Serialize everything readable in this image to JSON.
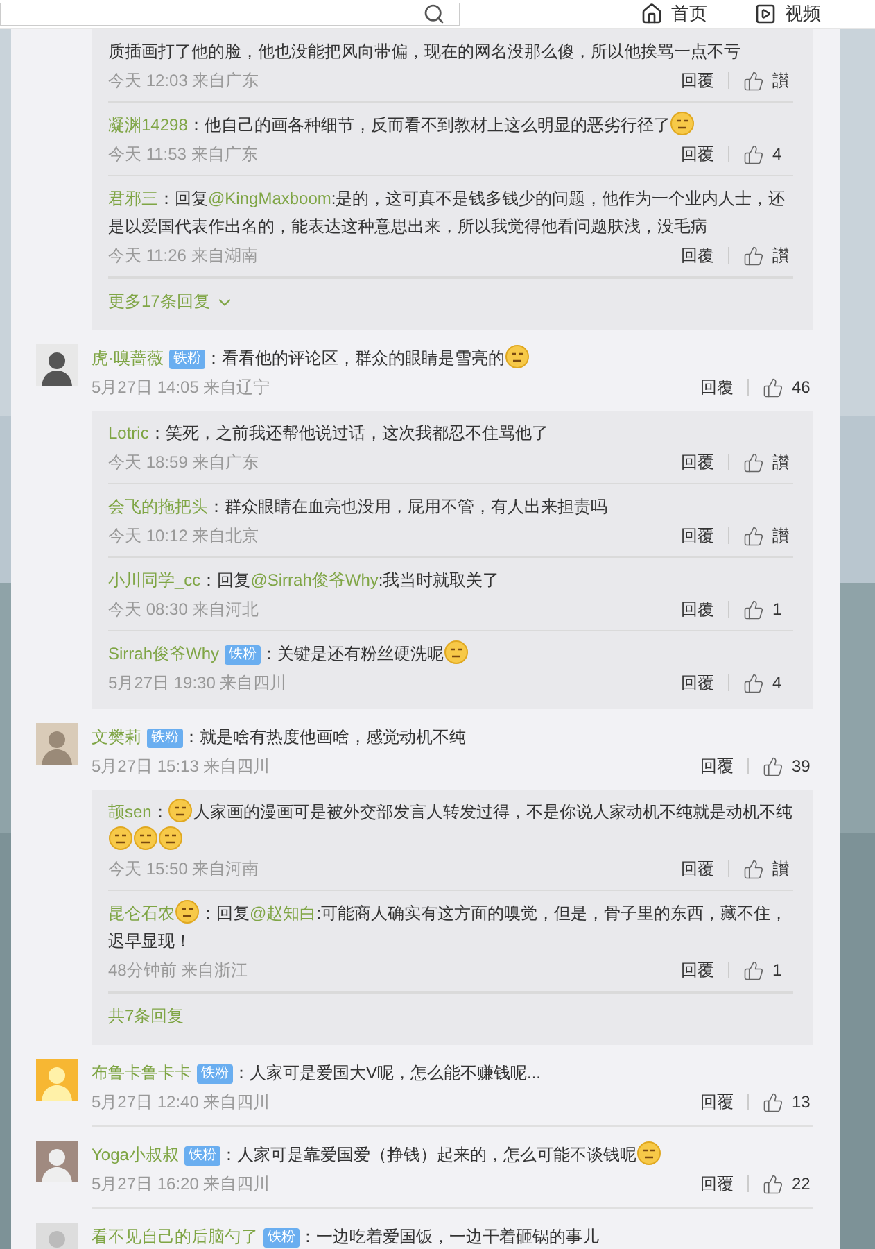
{
  "header": {
    "nav": [
      {
        "kind": "home",
        "label": "首页"
      },
      {
        "kind": "video",
        "label": "视频"
      }
    ]
  },
  "threads": [
    {
      "replies": [
        {
          "parts": [
            {
              "kind": "text",
              "text": "质插画打了他的脸，他也没能把风向带偏，现在的网名没那么傻，所以他挨骂一点不亏"
            }
          ],
          "time": "今天 12:03 来自广东",
          "reply": "回覆",
          "like": "讃"
        },
        {
          "author": "凝渊14298",
          "parts": [
            {
              "kind": "text",
              "text": "：他自己的画各种细节，反而看不到教材上这么明显的恶劣行径了"
            },
            {
              "kind": "emoji"
            }
          ],
          "time": "今天 11:53 来自广东",
          "reply": "回覆",
          "like": "4"
        },
        {
          "author": "君邪三",
          "parts": [
            {
              "kind": "text",
              "text": "：回复"
            },
            {
              "kind": "mention",
              "text": "@KingMaxboom"
            },
            {
              "kind": "text",
              "text": ":是的，这可真不是钱多钱少的问题，他作为一个业内人士，还是以爱国代表作出名的，能表达这种意思出来，所以我觉得他看问题肤浅，没毛病"
            }
          ],
          "time": "今天 11:26 来自湖南",
          "reply": "回覆",
          "like": "讃"
        }
      ],
      "footer": {
        "text": "更多17条回复",
        "chevron": true
      }
    },
    {
      "comment": {
        "author": "虎·嗅蔷薇",
        "badge": "铁粉",
        "parts": [
          {
            "kind": "text",
            "text": "：看看他的评论区，群众的眼睛是雪亮的"
          },
          {
            "kind": "emoji"
          }
        ],
        "time": "5月27日 14:05 来自辽宁",
        "reply": "回覆",
        "like": "46"
      },
      "replies": [
        {
          "author": "Lotric",
          "parts": [
            {
              "kind": "text",
              "text": "：笑死，之前我还帮他说过话，这次我都忍不住骂他了"
            }
          ],
          "time": "今天 18:59 来自广东",
          "reply": "回覆",
          "like": "讃"
        },
        {
          "author": "会飞的拖把头",
          "parts": [
            {
              "kind": "text",
              "text": "：群众眼睛在血亮也没用，屁用不管，有人出来担责吗"
            }
          ],
          "time": "今天 10:12 来自北京",
          "reply": "回覆",
          "like": "讃"
        },
        {
          "author": "小川同学_cc",
          "parts": [
            {
              "kind": "text",
              "text": "：回复"
            },
            {
              "kind": "mention",
              "text": "@Sirrah俊爷Why"
            },
            {
              "kind": "text",
              "text": ":我当时就取关了"
            }
          ],
          "time": "今天 08:30 来自河北",
          "reply": "回覆",
          "like": "1"
        },
        {
          "author": "Sirrah俊爷Why",
          "badge": "铁粉",
          "parts": [
            {
              "kind": "text",
              "text": "：关键是还有粉丝硬洗呢"
            },
            {
              "kind": "emoji"
            }
          ],
          "time": "5月27日 19:30 来自四川",
          "reply": "回覆",
          "like": "4"
        }
      ]
    },
    {
      "comment": {
        "author": "文樊莉",
        "badge": "铁粉",
        "parts": [
          {
            "kind": "text",
            "text": "：就是啥有热度他画啥，感觉动机不纯"
          }
        ],
        "time": "5月27日 15:13 来自四川",
        "reply": "回覆",
        "like": "39"
      },
      "replies": [
        {
          "author": "颉sen",
          "parts": [
            {
              "kind": "text",
              "text": "："
            },
            {
              "kind": "emoji"
            },
            {
              "kind": "text",
              "text": "人家画的漫画可是被外交部发言人转发过得，不是你说人家动机不纯就是动机不纯"
            },
            {
              "kind": "emoji"
            },
            {
              "kind": "emoji"
            },
            {
              "kind": "emoji"
            }
          ],
          "time": "今天 15:50 来自河南",
          "reply": "回覆",
          "like": "讃"
        },
        {
          "author": "昆仑石农",
          "parts": [
            {
              "kind": "emoji"
            },
            {
              "kind": "text",
              "text": "：回复"
            },
            {
              "kind": "mention",
              "text": "@赵知白"
            },
            {
              "kind": "text",
              "text": ":可能商人确实有这方面的嗅觉，但是，骨子里的东西，藏不住，迟早显现！"
            }
          ],
          "time": "48分钟前 来自浙江",
          "reply": "回覆",
          "like": "1"
        }
      ],
      "footer": {
        "text": "共7条回复",
        "chevron": false
      }
    },
    {
      "comment": {
        "author": "布鲁卡鲁卡卡",
        "badge": "铁粉",
        "parts": [
          {
            "kind": "text",
            "text": "：人家可是爱国大V呢，怎么能不赚钱呢..."
          }
        ],
        "time": "5月27日 12:40 来自四川",
        "reply": "回覆",
        "like": "13"
      }
    },
    {
      "comment": {
        "author": "Yoga小叔叔",
        "badge": "铁粉",
        "parts": [
          {
            "kind": "text",
            "text": "：人家可是靠爱国爱（挣钱）起来的，怎么可能不谈钱呢"
          },
          {
            "kind": "emoji"
          }
        ],
        "time": "5月27日 16:20 来自四川",
        "reply": "回覆",
        "like": "22"
      }
    },
    {
      "comment": {
        "author": "看不见自己的后脑勺了",
        "badge": "铁粉",
        "parts": [
          {
            "kind": "text",
            "text": "：一边吃着爱国饭，一边干着砸锅的事儿"
          }
        ]
      }
    }
  ]
}
